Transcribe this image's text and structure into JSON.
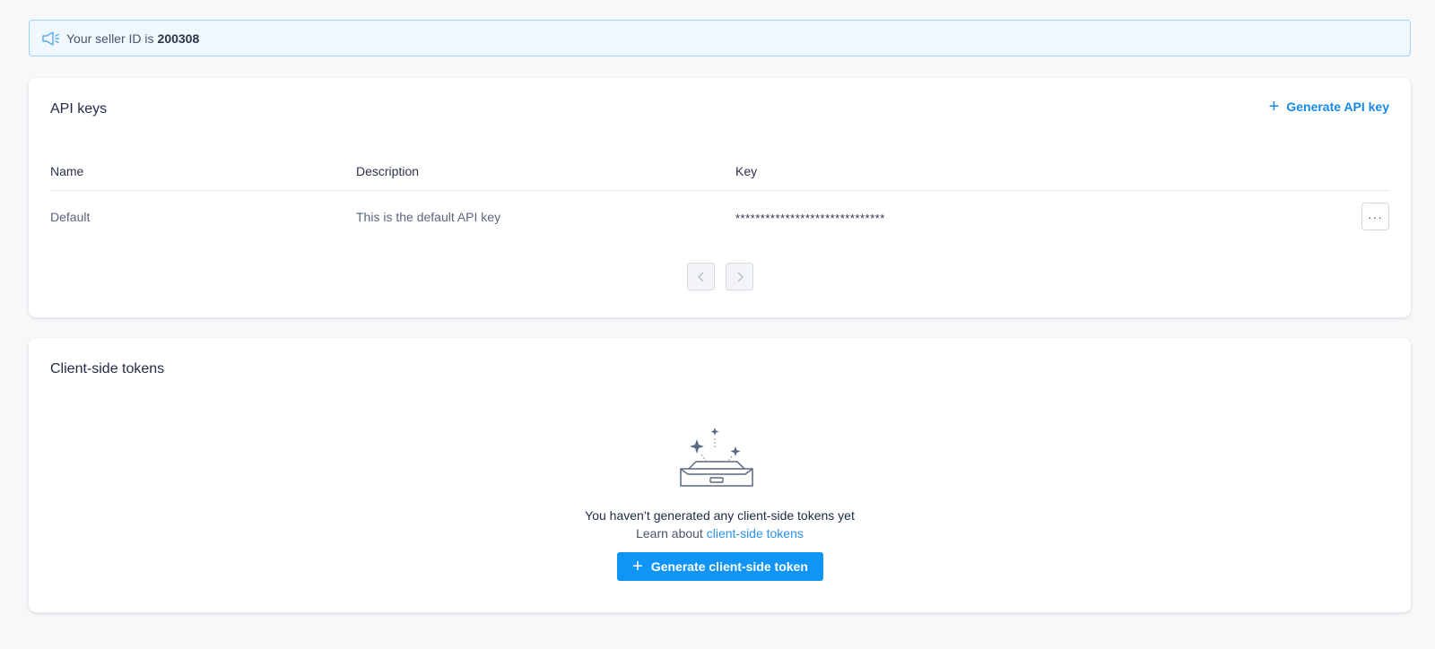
{
  "banner": {
    "text": "Your seller ID is",
    "seller_id": "200308",
    "icon": "megaphone-icon"
  },
  "api_keys": {
    "title": "API keys",
    "generate_label": "Generate API key",
    "columns": {
      "name": "Name",
      "description": "Description",
      "key": "Key"
    },
    "rows": [
      {
        "name": "Default",
        "description": "This is the default API key",
        "key": "******************************"
      }
    ],
    "more_label": "···",
    "pagination": {
      "prev_icon": "chevron-left-icon",
      "next_icon": "chevron-right-icon"
    }
  },
  "client_tokens": {
    "title": "Client-side tokens",
    "empty_message": "You haven’t generated any client-side tokens yet",
    "learn_prefix": "Learn about",
    "learn_link": "client-side tokens",
    "generate_label": "Generate client-side token",
    "illustration": "empty-inbox-icon"
  },
  "colors": {
    "accent": "#1094f5",
    "link": "#1689e6",
    "banner_bg": "#f0f8fe",
    "banner_border": "#9fd3f6"
  }
}
